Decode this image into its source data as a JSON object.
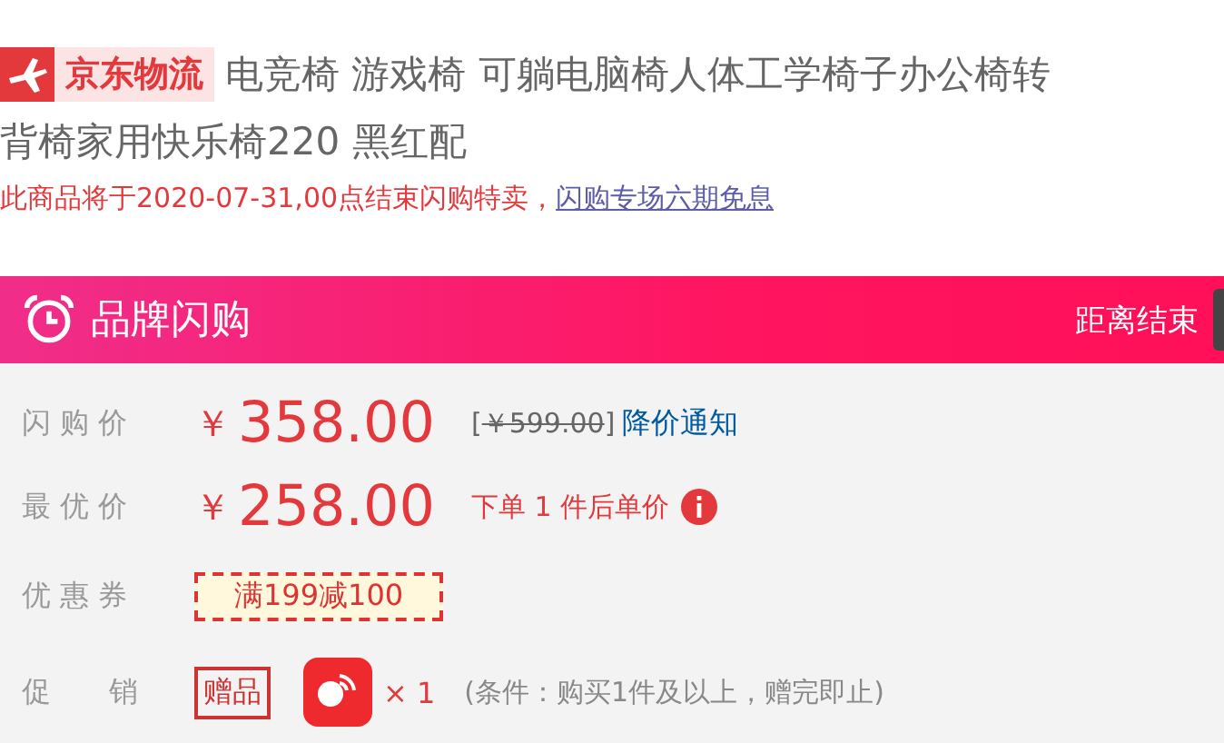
{
  "logistics_badge": {
    "label": "京东物流"
  },
  "title_lines": [
    "电竞椅 游戏椅 可躺电脑椅人体工学椅子办公椅转",
    "背椅家用快乐椅220 黑红配"
  ],
  "notice": {
    "text": "此商品将于2020-07-31,00点结束闪购特卖，",
    "link": "闪购专场六期免息"
  },
  "banner": {
    "title": "品牌闪购",
    "countdown_label": "距离结束"
  },
  "flash_price": {
    "label": "闪 购 价",
    "currency": "￥",
    "price": "358.00",
    "bracket_open": "[",
    "original_price": "￥599.00",
    "bracket_close": "]",
    "notify_link": "降价通知"
  },
  "best_price": {
    "label": "最 优 价",
    "currency": "￥",
    "price": "258.00",
    "note": "下单 1 件后单价"
  },
  "coupon": {
    "label": "优 惠 券",
    "tag": "满199减100"
  },
  "promotion": {
    "label": "促　　销",
    "tag": "赠品",
    "quantity": "× 1",
    "condition": "(条件：购买1件及以上，赠完即止)"
  }
}
